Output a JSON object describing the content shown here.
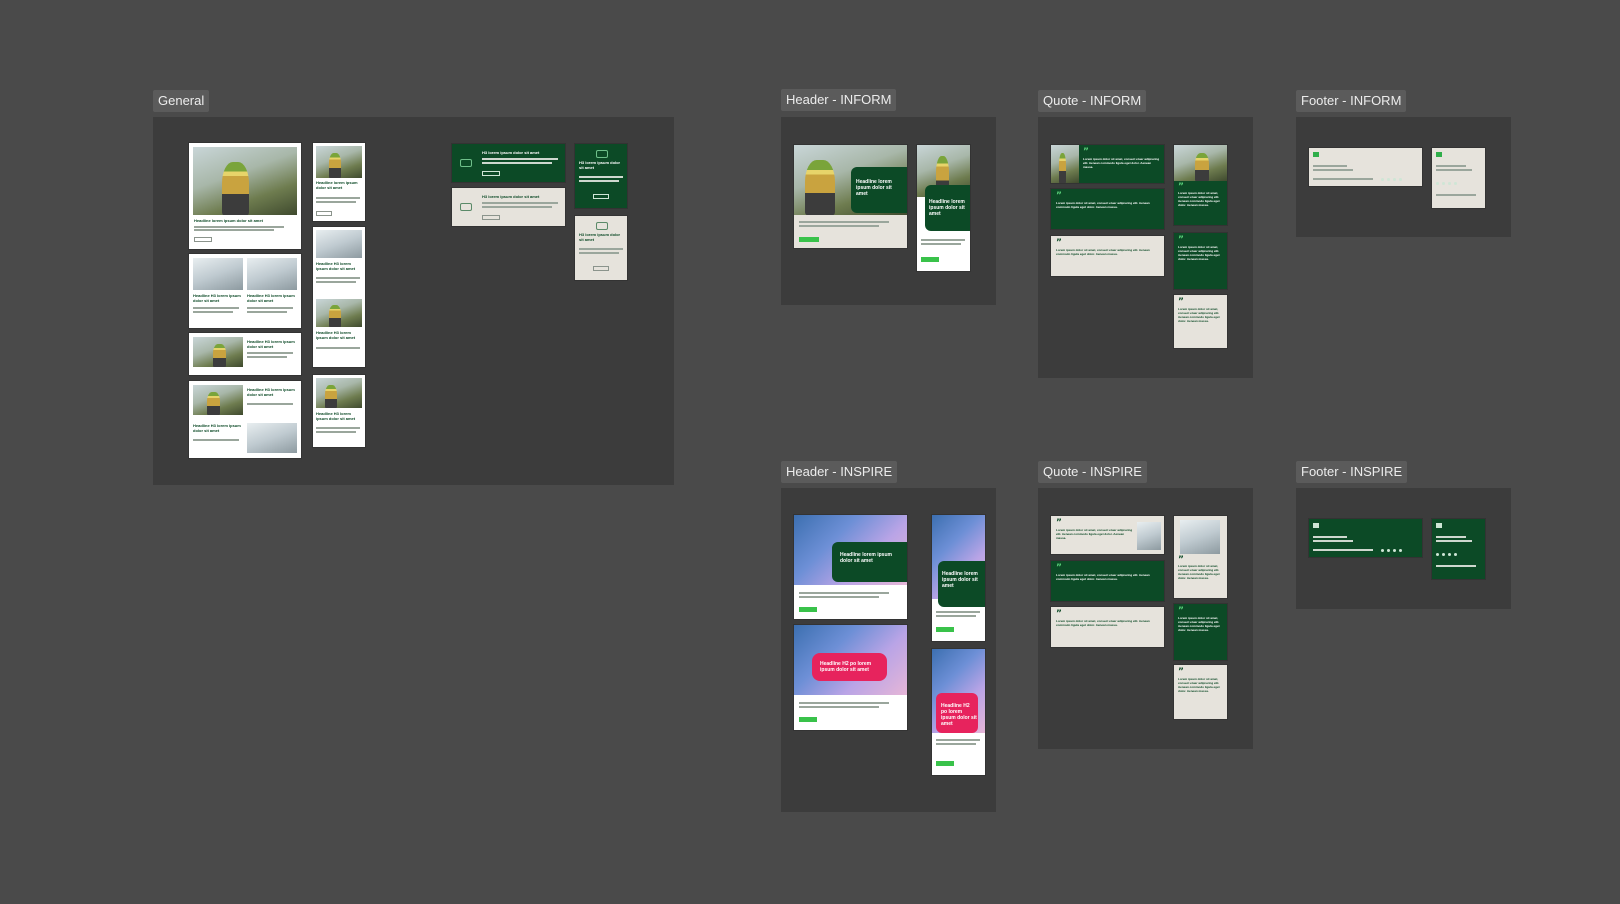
{
  "frames": {
    "general": "General",
    "header_inform": "Header - INFORM",
    "quote_inform": "Quote - INFORM",
    "footer_inform": "Footer - INFORM",
    "header_inspire": "Header - INSPIRE",
    "quote_inspire": "Quote - INSPIRE",
    "footer_inspire": "Footer - INSPIRE"
  },
  "mock_text": {
    "headline_long": "Headline lorem ipsum dolor sit amet",
    "headline_h2": "Headline H2 lorem ipsum dolor sit amet",
    "headline_h2_pink": "Headline H2 po lorem ipsum dolor sit amet",
    "headline_h3": "Headline H3 lorem ipsum dolor sit amet",
    "banner_headline": "H3 lorem ipsum dolor sit amet",
    "quote": "Lorem ipsum dolor sit amet, consect etuer adipiscing elit. Aenean commodo ligula eget dolor. Aenean massa."
  },
  "colors": {
    "canvas": "#4a4a4a",
    "frame": "#3c3c3c",
    "brand_green": "#0c4a26",
    "accent_green": "#39c24a",
    "accent_pink": "#e7235d",
    "beige": "#e6e3dc"
  }
}
